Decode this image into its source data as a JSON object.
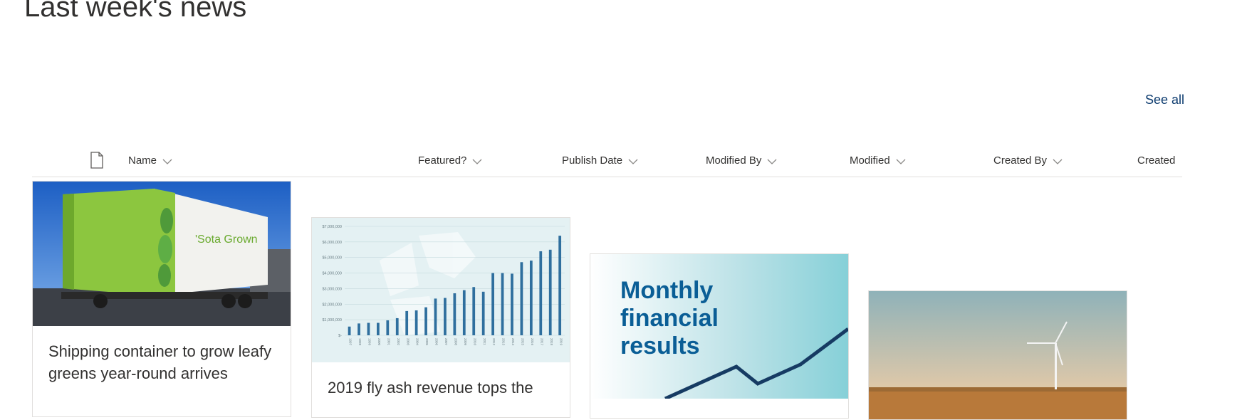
{
  "page": {
    "title": "Last week's news",
    "see_all": "See all"
  },
  "columns": {
    "name": "Name",
    "featured": "Featured?",
    "publish_date": "Publish Date",
    "modified_by": "Modified By",
    "modified": "Modified",
    "created_by": "Created By",
    "created": "Created"
  },
  "cards": [
    {
      "title": "Shipping container to grow leafy greens year-round arrives",
      "image": "shipping-container-photo",
      "brand_text": "'Sota Grown"
    },
    {
      "title": "2019 fly ash revenue tops the",
      "image": "fly-ash-revenue-chart"
    },
    {
      "title": "",
      "image": "monthly-financial-results-graphic",
      "image_text": [
        "Monthly",
        "financial",
        "results"
      ]
    },
    {
      "title": "",
      "image": "wind-turbine-photo"
    }
  ],
  "chart_image": {
    "y_ticks": [
      "$7,000,000",
      "$6,000,000",
      "$5,000,000",
      "$4,000,000",
      "$3,000,000",
      "$2,000,000",
      "$1,000,000",
      "$-"
    ],
    "years": [
      "1997",
      "1998",
      "1999",
      "2000",
      "2001",
      "2002",
      "2003",
      "2004",
      "2005",
      "2006",
      "2007",
      "2008",
      "2009",
      "2010",
      "2011",
      "2012",
      "2013",
      "2014",
      "2015",
      "2016",
      "2017",
      "2018",
      "2019"
    ]
  },
  "colors": {
    "accent": "#0b3a6e",
    "text": "#323130",
    "divider": "#e1dfdd",
    "container_green": "#8cc63f",
    "financial_text": "#0a5e96",
    "chart_bar": "#2f6f9e"
  }
}
